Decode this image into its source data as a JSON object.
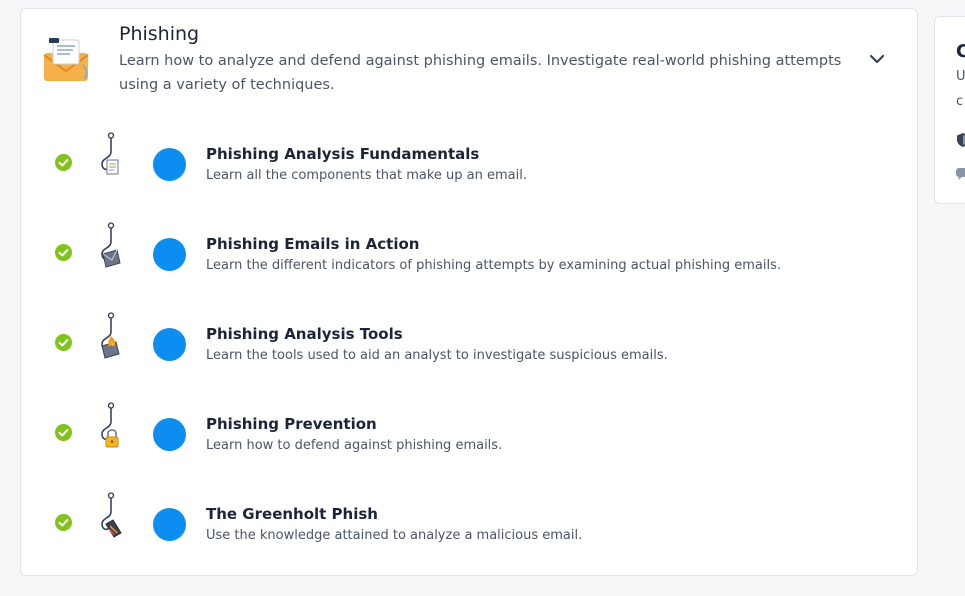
{
  "module": {
    "title": "Phishing",
    "description": "Learn how to analyze and defend against phishing emails. Investigate real-world phishing attempts using a variety of techniques.",
    "icon": "envelope-icon",
    "collapse_icon": "chevron-down-icon"
  },
  "rooms": [
    {
      "title": "Phishing Analysis Fundamentals",
      "description": "Learn all the components that make up an email.",
      "status": "completed",
      "icon": "hook-document-icon"
    },
    {
      "title": "Phishing Emails in Action",
      "description": "Learn the different indicators of phishing attempts by examining actual phishing emails.",
      "status": "completed",
      "icon": "hook-envelope-icon"
    },
    {
      "title": "Phishing Analysis Tools",
      "description": "Learn the tools used to aid an analyst to investigate suspicious emails.",
      "status": "completed",
      "icon": "hook-fire-envelope-icon"
    },
    {
      "title": "Phishing Prevention",
      "description": "Learn how to defend against phishing emails.",
      "status": "completed",
      "icon": "hook-padlock-icon"
    },
    {
      "title": "The Greenholt Phish",
      "description": "Use the knowledge attained to analyze a malicious email.",
      "status": "completed",
      "icon": "hook-tag-icon"
    }
  ],
  "side_card": {
    "title": "C",
    "lines": [
      "U",
      "c"
    ],
    "icons": [
      "shield-icon",
      "chat-icon"
    ]
  },
  "colors": {
    "accent": "#0b8ef0",
    "complete": "#7fc31c",
    "background": "#f6f7f9",
    "card": "#ffffff"
  }
}
